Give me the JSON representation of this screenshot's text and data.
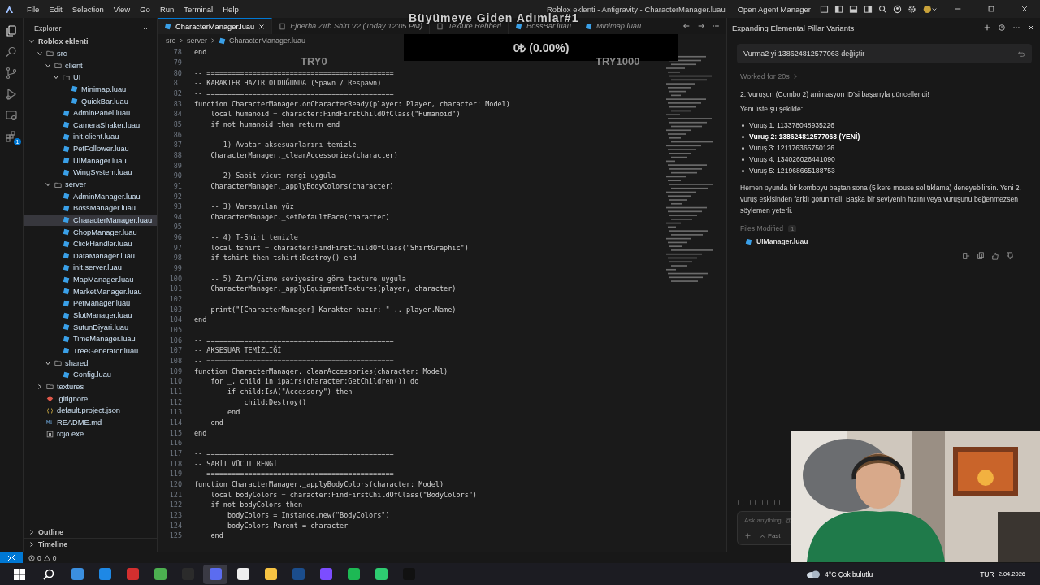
{
  "menu": [
    "File",
    "Edit",
    "Selection",
    "View",
    "Go",
    "Run",
    "Terminal",
    "Help"
  ],
  "window": {
    "title": "Roblox eklenti - Antigravity - CharacterManager.luau",
    "agent_button": "Open Agent Manager"
  },
  "activity_bar": [
    {
      "kind": "files",
      "selected": true
    },
    {
      "kind": "search",
      "selected": false
    },
    {
      "kind": "branch",
      "selected": false
    },
    {
      "kind": "debug",
      "selected": false
    },
    {
      "kind": "remote",
      "selected": false
    },
    {
      "kind": "extensions",
      "selected": false,
      "badge": "1"
    }
  ],
  "explorer": {
    "title": "Explorer",
    "more": "···",
    "tree": [
      {
        "name": "Roblox eklenti",
        "kind": "root",
        "expanded": true,
        "selected": false,
        "children": [
          {
            "name": "src",
            "kind": "folder",
            "expanded": true,
            "selected": false,
            "children": [
              {
                "name": "client",
                "kind": "folder",
                "expanded": true,
                "selected": false,
                "children": [
                  {
                    "name": "UI",
                    "kind": "folder",
                    "expanded": true,
                    "selected": false,
                    "children": [
                      {
                        "name": "Minimap.luau",
                        "kind": "luau",
                        "selected": false
                      },
                      {
                        "name": "QuickBar.luau",
                        "kind": "luau",
                        "selected": false
                      }
                    ]
                  },
                  {
                    "name": "AdminPanel.luau",
                    "kind": "luau",
                    "selected": false
                  },
                  {
                    "name": "CameraShaker.luau",
                    "kind": "luau",
                    "selected": false
                  },
                  {
                    "name": "init.client.luau",
                    "kind": "luau",
                    "selected": false
                  },
                  {
                    "name": "PetFollower.luau",
                    "kind": "luau",
                    "selected": false
                  },
                  {
                    "name": "UIManager.luau",
                    "kind": "luau",
                    "selected": false
                  },
                  {
                    "name": "WingSystem.luau",
                    "kind": "luau",
                    "selected": false
                  }
                ]
              },
              {
                "name": "server",
                "kind": "folder",
                "expanded": true,
                "selected": false,
                "children": [
                  {
                    "name": "AdminManager.luau",
                    "kind": "luau",
                    "selected": false
                  },
                  {
                    "name": "BossManager.luau",
                    "kind": "luau",
                    "selected": false
                  },
                  {
                    "name": "CharacterManager.luau",
                    "kind": "luau",
                    "selected": true
                  },
                  {
                    "name": "ChopManager.luau",
                    "kind": "luau",
                    "selected": false
                  },
                  {
                    "name": "ClickHandler.luau",
                    "kind": "luau",
                    "selected": false
                  },
                  {
                    "name": "DataManager.luau",
                    "kind": "luau",
                    "selected": false
                  },
                  {
                    "name": "init.server.luau",
                    "kind": "luau",
                    "selected": false
                  },
                  {
                    "name": "MapManager.luau",
                    "kind": "luau",
                    "selected": false
                  },
                  {
                    "name": "MarketManager.luau",
                    "kind": "luau",
                    "selected": false
                  },
                  {
                    "name": "PetManager.luau",
                    "kind": "luau",
                    "selected": false
                  },
                  {
                    "name": "SlotManager.luau",
                    "kind": "luau",
                    "selected": false
                  },
                  {
                    "name": "SutunDiyari.luau",
                    "kind": "luau",
                    "selected": false
                  },
                  {
                    "name": "TimeManager.luau",
                    "kind": "luau",
                    "selected": false
                  },
                  {
                    "name": "TreeGenerator.luau",
                    "kind": "luau",
                    "selected": false
                  }
                ]
              },
              {
                "name": "shared",
                "kind": "folder",
                "expanded": true,
                "selected": false,
                "children": [
                  {
                    "name": "Config.luau",
                    "kind": "luau",
                    "selected": false
                  }
                ]
              }
            ]
          },
          {
            "name": "textures",
            "kind": "folder",
            "expanded": false,
            "selected": false
          },
          {
            "name": ".gitignore",
            "kind": "git",
            "selected": false
          },
          {
            "name": "default.project.json",
            "kind": "json",
            "selected": false
          },
          {
            "name": "README.md",
            "kind": "md",
            "selected": false
          },
          {
            "name": "rojo.exe",
            "kind": "exe",
            "selected": false
          }
        ]
      }
    ],
    "sections": [
      {
        "label": "Outline",
        "expanded": false
      },
      {
        "label": "Timeline",
        "expanded": false
      }
    ]
  },
  "editor": {
    "tabs": [
      {
        "label": "CharacterManager.luau",
        "kind": "luau",
        "selected": true
      },
      {
        "label": "Ejderha Zırh Shirt V2 (Today 12:05 PM)",
        "kind": "doc",
        "selected": false
      },
      {
        "label": "Texture Rehberi",
        "kind": "doc",
        "selected": false
      },
      {
        "label": "BossBar.luau",
        "kind": "luau",
        "selected": false
      },
      {
        "label": "Minimap.luau",
        "kind": "luau",
        "selected": false
      }
    ],
    "breadcrumb": [
      "src",
      "server",
      "CharacterManager.luau"
    ],
    "lines": [
      {
        "n": "78",
        "text": "end"
      },
      {
        "n": "79"
      },
      {
        "n": "80",
        "text": "-- =============================================",
        "kind": "comment"
      },
      {
        "n": "81",
        "text": "-- KARAKTER HAZIR OLDUĞUNDA (Spawn / Respawn)",
        "kind": "comment"
      },
      {
        "n": "82",
        "text": "-- =============================================",
        "kind": "comment"
      },
      {
        "n": "83",
        "text": "function CharacterManager.onCharacterReady(player: Player, character: Model)"
      },
      {
        "n": "84",
        "text": "    local humanoid = character:FindFirstChildOfClass(\"Humanoid\")"
      },
      {
        "n": "85",
        "text": "    if not humanoid then return end"
      },
      {
        "n": "86"
      },
      {
        "n": "87",
        "text": "    -- 1) Avatar aksesuarlarını temizle",
        "kind": "comment"
      },
      {
        "n": "88",
        "text": "    CharacterManager._clearAccessories(character)"
      },
      {
        "n": "89"
      },
      {
        "n": "90",
        "text": "    -- 2) Sabit vücut rengi uygula",
        "kind": "comment"
      },
      {
        "n": "91",
        "text": "    CharacterManager._applyBodyColors(character)"
      },
      {
        "n": "92"
      },
      {
        "n": "93",
        "text": "    -- 3) Varsayılan yüz",
        "kind": "comment"
      },
      {
        "n": "94",
        "text": "    CharacterManager._setDefaultFace(character)"
      },
      {
        "n": "95"
      },
      {
        "n": "96",
        "text": "    -- 4) T-Shirt temizle",
        "kind": "comment"
      },
      {
        "n": "97",
        "text": "    local tshirt = character:FindFirstChildOfClass(\"ShirtGraphic\")"
      },
      {
        "n": "98",
        "text": "    if tshirt then tshirt:Destroy() end"
      },
      {
        "n": "99"
      },
      {
        "n": "100",
        "text": "    -- 5) Zırh/Çizme seviyesine göre texture uygula",
        "kind": "comment"
      },
      {
        "n": "101",
        "text": "    CharacterManager._applyEquipmentTextures(player, character)"
      },
      {
        "n": "102"
      },
      {
        "n": "103",
        "text": "    print(\"[CharacterManager] Karakter hazır: \" .. player.Name)"
      },
      {
        "n": "104",
        "text": "end"
      },
      {
        "n": "105"
      },
      {
        "n": "106",
        "text": "-- =============================================",
        "kind": "comment"
      },
      {
        "n": "107",
        "text": "-- AKSESUAR TEMİZLİĞİ",
        "kind": "comment"
      },
      {
        "n": "108",
        "text": "-- =============================================",
        "kind": "comment"
      },
      {
        "n": "109",
        "text": "function CharacterManager._clearAccessories(character: Model)"
      },
      {
        "n": "110",
        "text": "    for _, child in ipairs(character:GetChildren()) do"
      },
      {
        "n": "111",
        "text": "        if child:IsA(\"Accessory\") then"
      },
      {
        "n": "112",
        "text": "            child:Destroy()"
      },
      {
        "n": "113",
        "text": "        end"
      },
      {
        "n": "114",
        "text": "    end"
      },
      {
        "n": "115",
        "text": "end"
      },
      {
        "n": "116"
      },
      {
        "n": "117",
        "text": "-- =============================================",
        "kind": "comment"
      },
      {
        "n": "118",
        "text": "-- SABİT VÜCUT RENGİ",
        "kind": "comment"
      },
      {
        "n": "119",
        "text": "-- =============================================",
        "kind": "comment"
      },
      {
        "n": "120",
        "text": "function CharacterManager._applyBodyColors(character: Model)"
      },
      {
        "n": "121",
        "text": "    local bodyColors = character:FindFirstChildOfClass(\"BodyColors\")"
      },
      {
        "n": "122",
        "text": "    if not bodyColors then"
      },
      {
        "n": "123",
        "text": "        bodyColors = Instance.new(\"BodyColors\")"
      },
      {
        "n": "124",
        "text": "        bodyColors.Parent = character"
      },
      {
        "n": "125",
        "text": "    end"
      }
    ]
  },
  "overlay": {
    "title": "Büyümeye Giden Adımlar#1",
    "balance": "0₺ (0.00%)",
    "left_goal": "TRY0",
    "right_goal": "TRY1000"
  },
  "agent_panel": {
    "title": "Expanding Elemental Pillar Variants",
    "prompt": "Vurma2 yi 138624812577063 değiştir",
    "worked": "Worked for 20s",
    "heading": "2. Vuruşun (Combo 2) animasyon ID'si başarıyla güncellendi!",
    "intro": "Yeni liste şu şekilde:",
    "items": [
      {
        "text": "Vuruş 1: 113378048935226",
        "bold": false
      },
      {
        "text": "Vuruş 2: 138624812577063 (YENİ)",
        "bold": true
      },
      {
        "text": "Vuruş 3: 121176365750126",
        "bold": false
      },
      {
        "text": "Vuruş 4: 134026026441090",
        "bold": false
      },
      {
        "text": "Vuruş 5: 121968665188753",
        "bold": false
      }
    ],
    "message": "Hemen oyunda bir komboyu baştan sona (5 kere mouse sol tıklama) deneyebilirsin. Yeni 2. vuruş eskisinden farklı görünmeli. Başka bir seviyenin hızını veya vuruşunu beğenmezsen söylemen yeterli.",
    "files_label": "Files Modified",
    "files_count": "1",
    "files": [
      "UIManager.luau"
    ],
    "input": {
      "placeholder": "Ask anything, @",
      "mode": "Fast"
    }
  },
  "status_bar": {
    "errors": "0",
    "warnings": "0"
  },
  "taskbar": {
    "apps": [
      {
        "color": "#3b8fe0",
        "selected": false
      },
      {
        "color": "#1e88e5",
        "selected": false
      },
      {
        "color": "#d32f2f",
        "selected": false
      },
      {
        "color": "#4caf50",
        "selected": false
      },
      {
        "color": "#2b2b2b",
        "selected": false
      },
      {
        "color": "#5b6cf0",
        "selected": true
      },
      {
        "color": "#eeeeee",
        "selected": false
      },
      {
        "color": "#f6c343",
        "selected": false
      },
      {
        "color": "#1b4d8c",
        "selected": false
      },
      {
        "color": "#7c4dff",
        "selected": false
      },
      {
        "color": "#1db954",
        "selected": false
      },
      {
        "color": "#2ecc71",
        "selected": false
      },
      {
        "color": "#111111",
        "selected": false
      }
    ],
    "weather": "4°C  Çok bulutlu",
    "language": "TUR",
    "date": "2.04.2026"
  }
}
